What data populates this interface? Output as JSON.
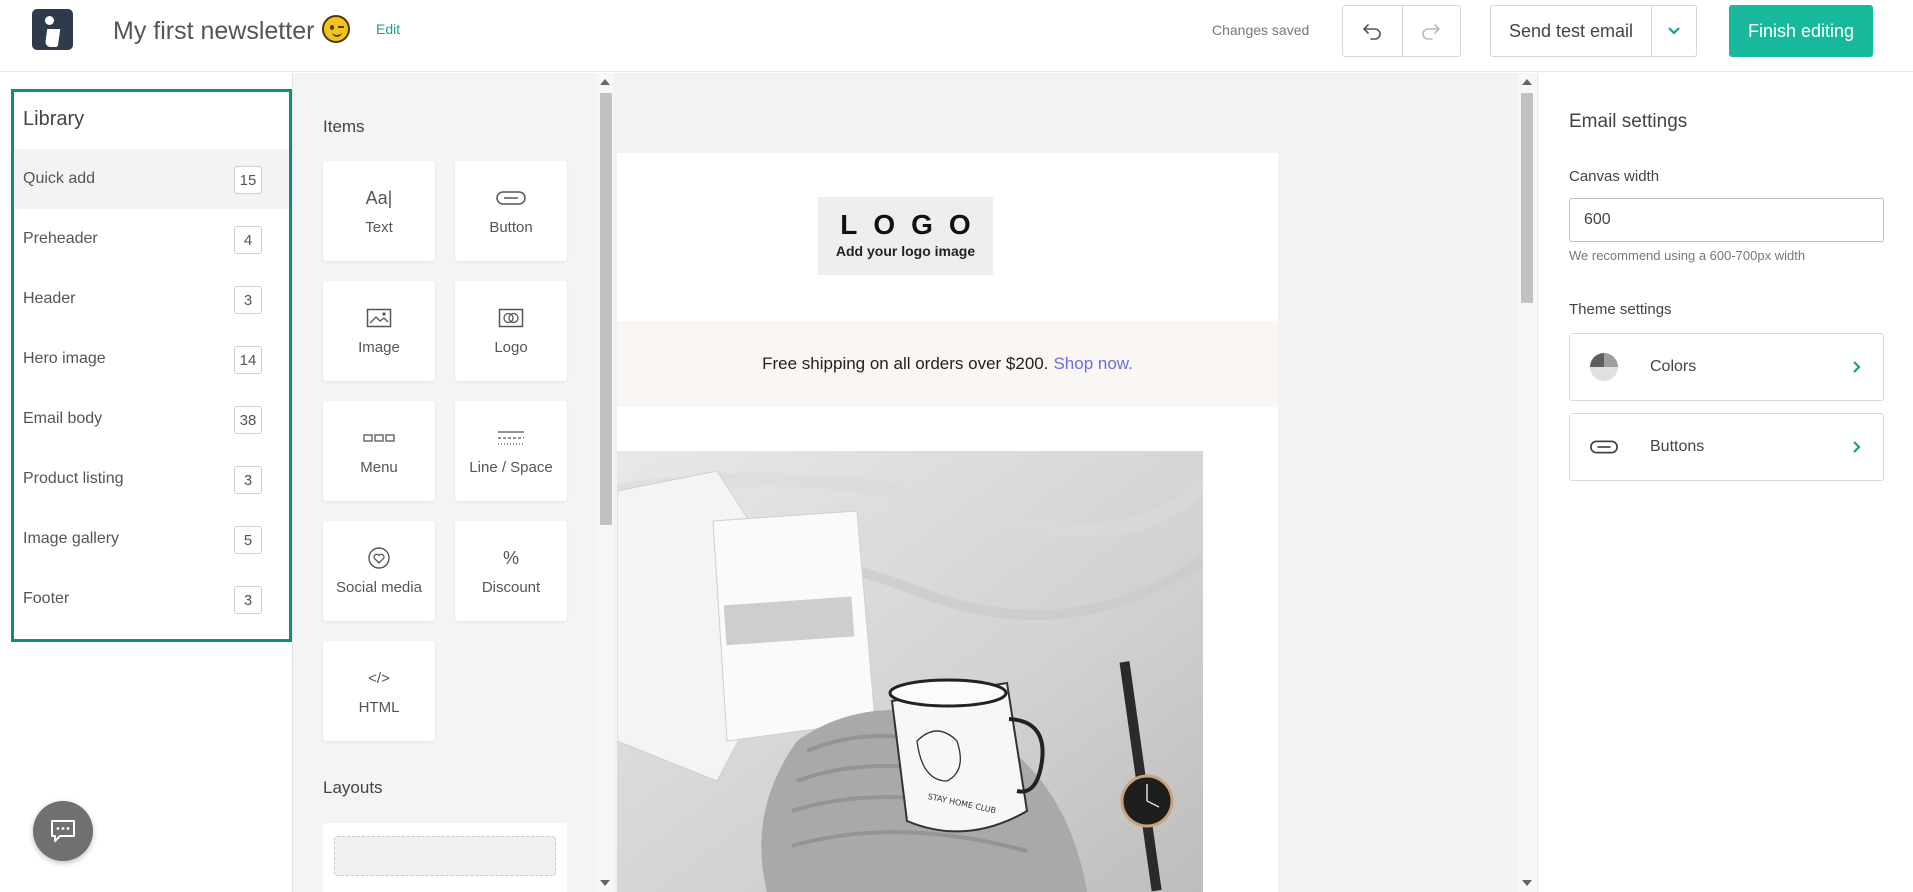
{
  "header": {
    "title": "My first newsletter",
    "edit_label": "Edit",
    "status": "Changes saved",
    "send_test_label": "Send test email",
    "finish_label": "Finish editing",
    "accent_color": "#17b89c"
  },
  "library": {
    "title": "Library",
    "items": [
      {
        "label": "Quick add",
        "count": "15"
      },
      {
        "label": "Preheader",
        "count": "4"
      },
      {
        "label": "Header",
        "count": "3"
      },
      {
        "label": "Hero image",
        "count": "14"
      },
      {
        "label": "Email body",
        "count": "38"
      },
      {
        "label": "Product listing",
        "count": "3"
      },
      {
        "label": "Image gallery",
        "count": "5"
      },
      {
        "label": "Footer",
        "count": "3"
      }
    ]
  },
  "items_panel": {
    "title": "Items",
    "items": [
      {
        "label": "Text",
        "icon": "text-icon"
      },
      {
        "label": "Button",
        "icon": "button-icon"
      },
      {
        "label": "Image",
        "icon": "image-icon"
      },
      {
        "label": "Logo",
        "icon": "logo-icon"
      },
      {
        "label": "Menu",
        "icon": "menu-icon"
      },
      {
        "label": "Line / Space",
        "icon": "line-space-icon"
      },
      {
        "label": "Social media",
        "icon": "social-media-icon"
      },
      {
        "label": "Discount",
        "icon": "discount-icon"
      },
      {
        "label": "HTML",
        "icon": "html-icon"
      }
    ],
    "text_icon_glyph": "Aa|",
    "discount_icon_glyph": "%",
    "html_icon_glyph": "</>",
    "layouts_title": "Layouts"
  },
  "canvas": {
    "logo_text": "LOGO",
    "logo_subtext": "Add your logo image",
    "shipping_text": "Free shipping on all orders over $200.",
    "shipping_link": "Shop now.",
    "mug_text": "STAY HOME CLUB"
  },
  "settings": {
    "title": "Email settings",
    "canvas_width_label": "Canvas width",
    "canvas_width_value": "600",
    "canvas_width_hint": "We recommend using a 600-700px width",
    "theme_label": "Theme settings",
    "theme_rows": [
      {
        "label": "Colors",
        "icon": "colors-icon"
      },
      {
        "label": "Buttons",
        "icon": "buttons-icon"
      }
    ]
  }
}
